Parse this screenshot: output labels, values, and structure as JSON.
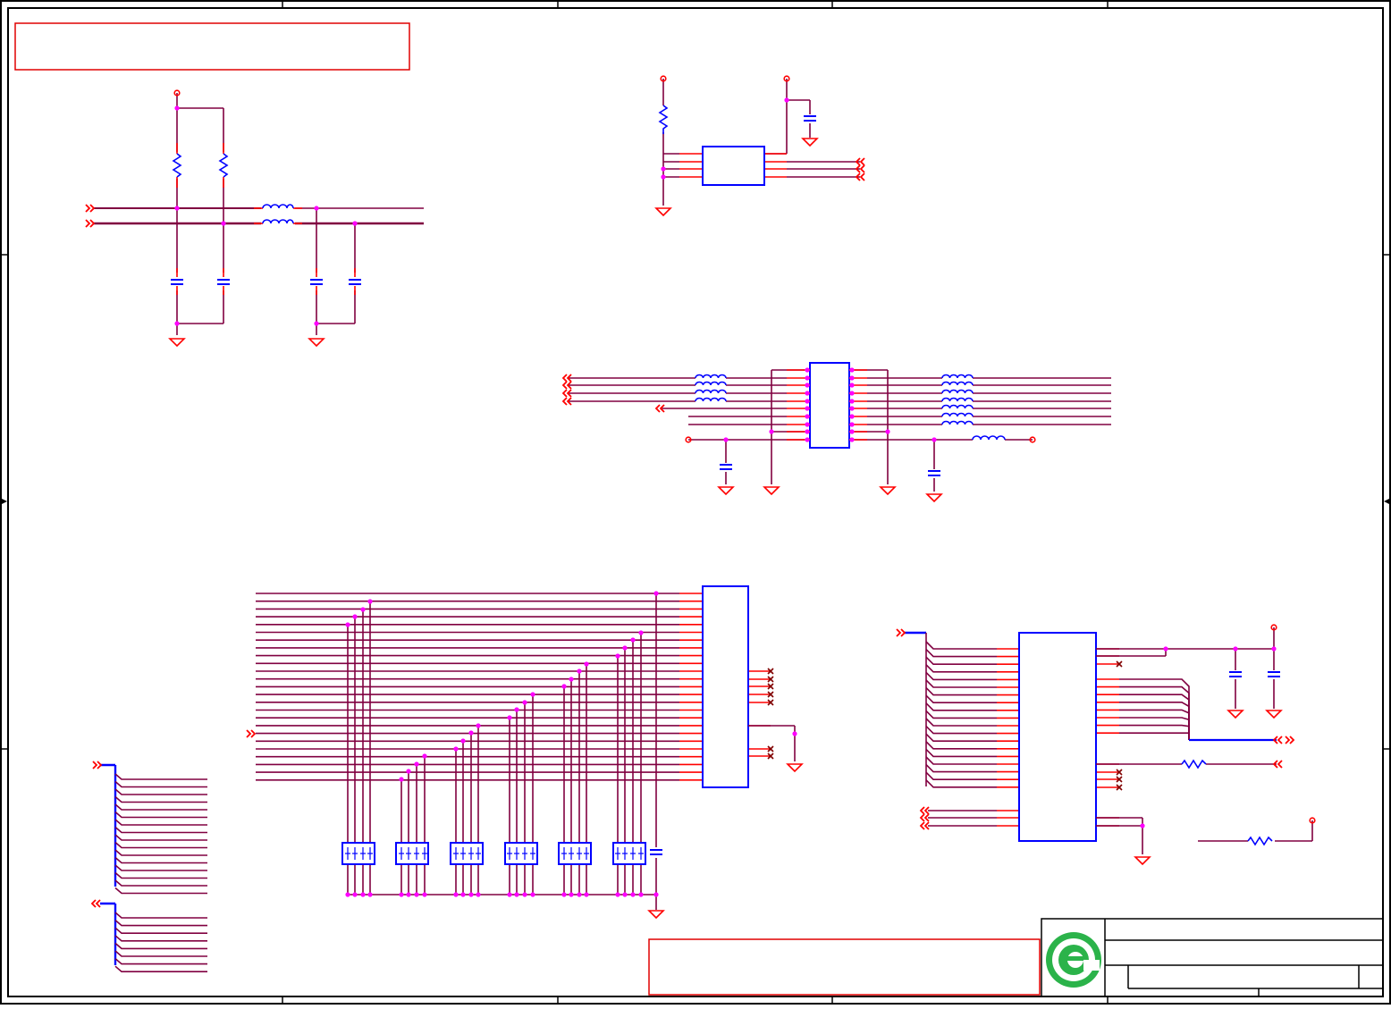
{
  "sheet": {
    "zone_columns": 5,
    "zone_rows": 4,
    "colors": {
      "border": "#000000",
      "wire": "#800040",
      "pin": "#ff0000",
      "part": "#0000ff",
      "junction": "#ff00ff",
      "note_box": "#e00000",
      "no_connect": "#800000"
    }
  },
  "title_block": {
    "logo_icon": "green-e-logo",
    "logo_color": "#2bb34a"
  }
}
